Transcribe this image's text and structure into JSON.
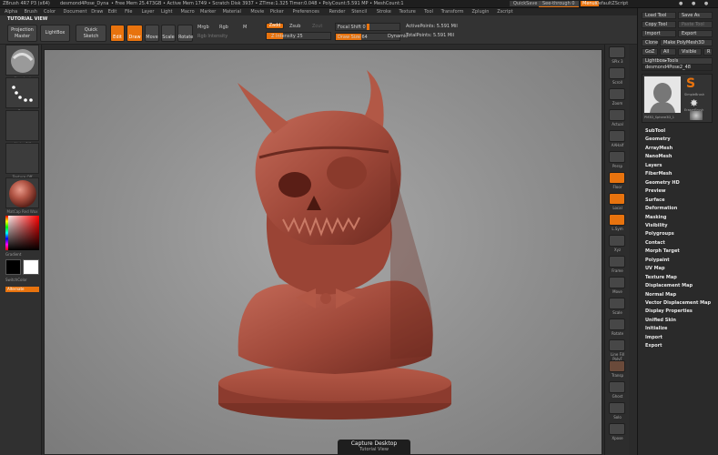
{
  "titlebar": {
    "app": "ZBrush 4R7 P3 (x64)",
    "file": "desmond4Pose_Dyna",
    "free_mem": "• Free Mem 25.473GB • Active Mem 1749 • Scratch Disk 3937 • ZTime:1.325 Timer:0.048 • PolyCount:5.591 MP • MeshCount:1",
    "quicksave": "QuickSave",
    "seethrough": "See-through 0",
    "menus": "Menus",
    "script": "DefaultZScript"
  },
  "menubar": [
    "Alpha",
    "Brush",
    "Color",
    "Document",
    "Draw",
    "Edit",
    "File",
    "Layer",
    "Light",
    "Macro",
    "Marker",
    "Material",
    "Movie",
    "Picker",
    "Preferences",
    "Render",
    "Stencil",
    "Stroke",
    "Texture",
    "Tool",
    "Transform",
    "Zplugin",
    "Zscript"
  ],
  "toolbar": {
    "tutorial": "TUTORIAL VIEW",
    "projection": "Projection Master",
    "lightbox": "LightBox",
    "quicksketch": "Quick Sketch",
    "edit": "Edit",
    "draw": "Draw",
    "move": "Move",
    "scale": "Scale",
    "rotate": "Rotate",
    "mrgb": "Mrgb",
    "rgb": "Rgb",
    "m": "M",
    "zadd": "Zadd",
    "zsub": "Zsub",
    "zcut": "Zcut",
    "rgb_intensity": "Rgb Intensity",
    "z_intensity": "Z Intensity 25",
    "focal_shift": "Focal Shift 0",
    "draw_size": "Draw Size 64",
    "dynamic": "Dynamic",
    "active_points": "ActivePoints: 5.591 Mil",
    "total_points": "TotalPoints: 5.591 Mil"
  },
  "leftcol": {
    "brush": "Standard",
    "stroke": "Dots",
    "alpha": "Alpha Off",
    "texture": "Texture Off",
    "material": "MatCap Red Wax",
    "gradient": "Gradient",
    "switchcolor": "SwitchColor",
    "alternate": "Alternate"
  },
  "viewport": {
    "capture": "Capture Desktop",
    "tutorial_tab": "Tutorial View"
  },
  "rstrip": [
    "SPix 3",
    "Scroll",
    "Zoom",
    "Actual",
    "AAHalf",
    "Persp",
    "Floor",
    "Local",
    "L.Sym",
    "Xyz",
    "Frame",
    "Move",
    "Scale",
    "Rotate",
    "Line Fill PolyF",
    "Transp",
    "Ghost",
    "Solo",
    "Xpose"
  ],
  "rpanel": {
    "load": "Load Tool",
    "saveas": "Save As",
    "copy": "Copy Tool",
    "paste": "Paste Tool",
    "import": "Import",
    "export": "Export",
    "clone": "Clone",
    "make_polymesh": "Make PolyMesh3D",
    "goz": "GoZ",
    "all": "All",
    "visible": "Visible",
    "r": "R",
    "lightbox_tools": "Lightbox▸Tools",
    "current_tool": "desmond4Pose2_48",
    "thumbs": [
      "desmond4Pose",
      "SimpleBrush",
      "EraserBrush",
      "PM3D_Sphere3D_1"
    ],
    "menu": [
      "SubTool",
      "Geometry",
      "ArrayMesh",
      "NanoMesh",
      "Layers",
      "FiberMesh",
      "Geometry HD",
      "Preview",
      "Surface",
      "Deformation",
      "Masking",
      "Visibility",
      "Polygroups",
      "Contact",
      "Morph Target",
      "Polypaint",
      "UV Map",
      "Texture Map",
      "Displacement Map",
      "Normal Map",
      "Vector Displacement Map",
      "Display Properties",
      "Unified Skin",
      "Initialize",
      "Import",
      "Export"
    ]
  },
  "colors": {
    "accent": "#e8730e",
    "sculpt": "#a0493a",
    "viewport": "#8e8e8e"
  }
}
